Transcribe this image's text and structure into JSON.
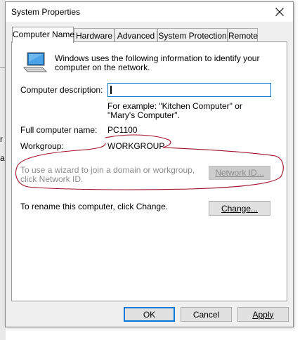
{
  "background_window": {
    "text_fragments": [
      "r",
      "a"
    ]
  },
  "dialog": {
    "title": "System Properties",
    "close_label": "✕"
  },
  "tabs": [
    {
      "label": "Computer Name",
      "active": true
    },
    {
      "label": "Hardware",
      "active": false
    },
    {
      "label": "Advanced",
      "active": false
    },
    {
      "label": "System Protection",
      "active": false
    },
    {
      "label": "Remote",
      "active": false
    }
  ],
  "computer_name_tab": {
    "intro": "Windows uses the following information to identify your computer on the network.",
    "description_label": "Computer description:",
    "description_value": "",
    "description_example": "For example: \"Kitchen Computer\" or \"Mary's Computer\".",
    "full_name_label": "Full computer name:",
    "full_name_value": "PC1100",
    "workgroup_label": "Workgroup:",
    "workgroup_value": "WORKGROUP",
    "network_id_text": "To use a wizard to join a domain or workgroup, click Network ID.",
    "network_id_button": "Network ID...",
    "network_id_button_enabled": false,
    "rename_text": "To rename this computer, click Change.",
    "change_button": "Change..."
  },
  "footer": {
    "ok": "OK",
    "cancel": "Cancel",
    "apply": "Apply"
  },
  "colors": {
    "annotation": "#a0102a",
    "focus_border": "#0078d7"
  },
  "icons": {
    "computer": "computer-icon",
    "close": "close-icon"
  }
}
